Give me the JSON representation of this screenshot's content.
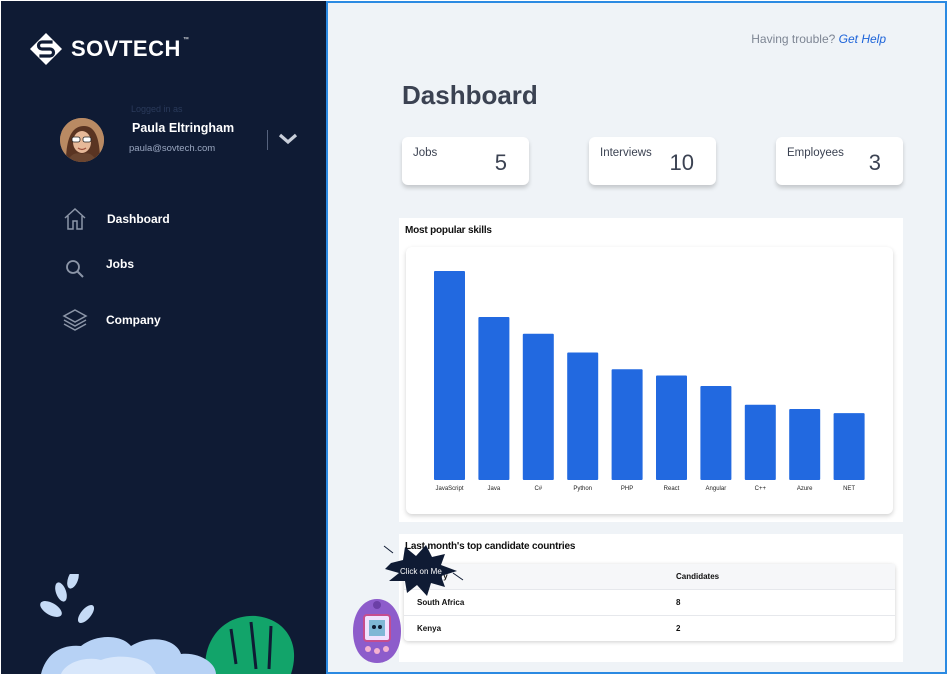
{
  "brand": {
    "name": "SOVTECH",
    "trademark": "™"
  },
  "user": {
    "faint_label": "Logged in as",
    "name": "Paula Eltringham",
    "email": "paula@sovtech.com"
  },
  "nav": [
    {
      "label": "Dashboard",
      "icon": "home-icon"
    },
    {
      "label": "Jobs",
      "icon": "search-icon"
    },
    {
      "label": "Company",
      "icon": "layers-icon"
    }
  ],
  "help": {
    "prefix": "Having trouble?",
    "link": "Get Help"
  },
  "page": {
    "title": "Dashboard"
  },
  "stats": [
    {
      "label": "Jobs",
      "value": "5"
    },
    {
      "label": "Interviews",
      "value": "10"
    },
    {
      "label": "Employees",
      "value": "3"
    }
  ],
  "skills": {
    "title": "Most popular skills"
  },
  "chart_data": {
    "type": "bar",
    "title": "Most popular skills",
    "categories": [
      "JavaScript",
      "Java",
      "C#",
      "Python",
      "PHP",
      "React",
      "Angular",
      "C++",
      "Azure",
      "NET"
    ],
    "values": [
      100,
      78,
      70,
      61,
      53,
      50,
      45,
      36,
      34,
      32
    ],
    "ylim": [
      0,
      100
    ],
    "grid": false,
    "color": "#2269e0"
  },
  "countries": {
    "title": "Last month's top candidate countries",
    "columns": [
      "Country",
      "Candidates"
    ],
    "rows": [
      {
        "country": "South Africa",
        "candidates": "8"
      },
      {
        "country": "Kenya",
        "candidates": "2"
      }
    ]
  },
  "widget": {
    "label": "Click on Me"
  },
  "colors": {
    "sidebar": "#0f1b34",
    "accent": "#2269e0",
    "link": "#1c63d9",
    "main_bg": "#eff3f7",
    "main_border": "#2b8ae2"
  }
}
